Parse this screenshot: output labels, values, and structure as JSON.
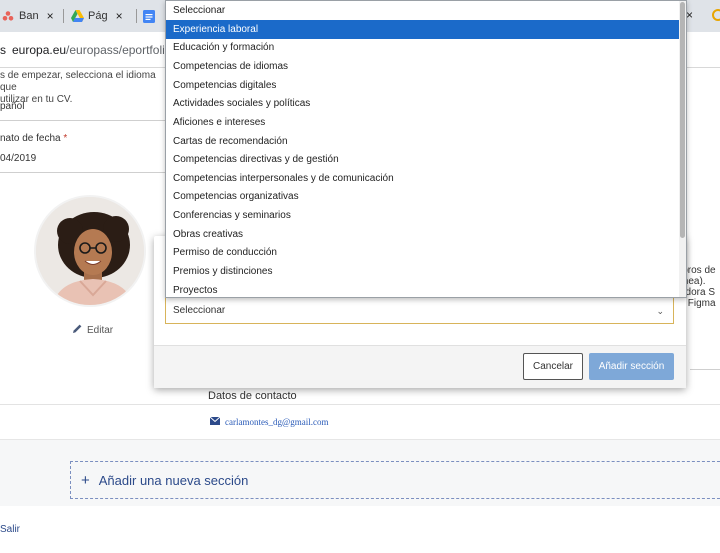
{
  "browser": {
    "tabs": [
      {
        "label": "Ban",
        "icon": "asana-icon",
        "color": "#e8635a"
      },
      {
        "label": "Pág",
        "icon": "drive-icon",
        "color": "#34a853"
      },
      {
        "label": "",
        "icon": "docs-icon",
        "color": "#4285f4"
      }
    ],
    "tab_close": "×",
    "right_close": "×",
    "address": {
      "prefix": "s",
      "host": "europa.eu",
      "path": "/europass/eportfolio/s"
    }
  },
  "page": {
    "language_hint": "s de empezar, selecciona el idioma que\nutilizar en tu CV.",
    "language_value": "pañol",
    "date_format_label": "nato de fecha",
    "required_mark": "*",
    "date_format_value": "04/2019",
    "edit_label": "Editar",
    "right_text": "ibros de\nínea).\nadora S\ny Figma",
    "contact_title": "Datos de contacto",
    "contact_email": "carlamontes_dg@gmail.com",
    "add_section_label": "Añadir una nueva sección",
    "add_section_plus": "+",
    "exit_label": "Salir"
  },
  "modal": {
    "select_value": "Seleccionar",
    "select_chevron": "⌄",
    "cancel_label": "Cancelar",
    "add_label": "Añadir sección"
  },
  "dropdown": {
    "selected_index": 1,
    "options": [
      "Seleccionar",
      "Experiencia laboral",
      "Educación y formación",
      "Competencias de idiomas",
      "Competencias digitales",
      "Actividades sociales y políticas",
      "Aficiones e intereses",
      "Cartas de recomendación",
      "Competencias directivas y de gestión",
      "Competencias interpersonales y de comunicación",
      "Competencias organizativas",
      "Conferencias y seminarios",
      "Obras creativas",
      "Permiso de conducción",
      "Premios y distinciones",
      "Proyectos"
    ]
  },
  "colors": {
    "accent_blue": "#1b6ac9",
    "add_button": "#7ea8d8",
    "select_border": "#d8b45a",
    "link_blue": "#2c4a8a"
  }
}
